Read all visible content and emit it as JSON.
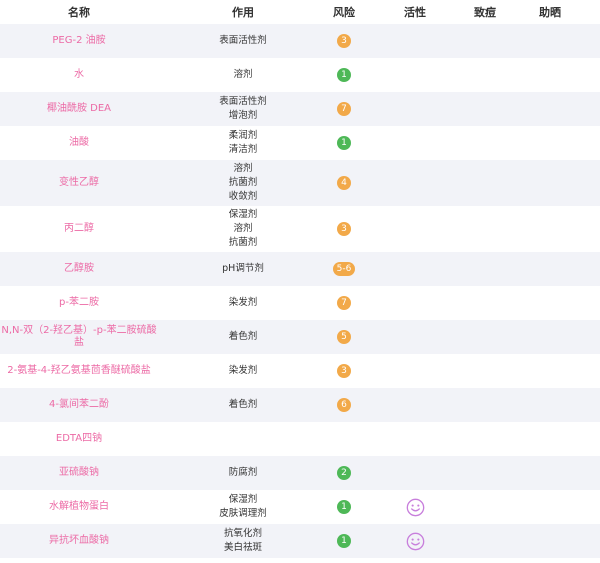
{
  "headers": {
    "name": "名称",
    "function": "作用",
    "risk": "风险",
    "active": "活性",
    "acne": "致痘",
    "acne2": "助晒"
  },
  "colors": {
    "green": "#4eb857",
    "orange": "#f2a949",
    "pink": "#ec6aa5",
    "smile": "#c87fdc"
  },
  "rows": [
    {
      "name": "PEG-2 油胺",
      "functions": [
        "表面活性剂"
      ],
      "risk": "3",
      "risk_color": "orange",
      "active": false
    },
    {
      "name": "水",
      "functions": [
        "溶剂"
      ],
      "risk": "1",
      "risk_color": "green",
      "active": false
    },
    {
      "name": "椰油酰胺 DEA",
      "functions": [
        "表面活性剂",
        "增泡剂"
      ],
      "risk": "7",
      "risk_color": "orange",
      "active": false
    },
    {
      "name": "油酸",
      "functions": [
        "柔润剂",
        "清洁剂"
      ],
      "risk": "1",
      "risk_color": "green",
      "active": false
    },
    {
      "name": "变性乙醇",
      "functions": [
        "溶剂",
        "抗菌剂",
        "收敛剂"
      ],
      "risk": "4",
      "risk_color": "orange",
      "active": false
    },
    {
      "name": "丙二醇",
      "functions": [
        "保湿剂",
        "溶剂",
        "抗菌剂"
      ],
      "risk": "3",
      "risk_color": "orange",
      "active": false
    },
    {
      "name": "乙醇胺",
      "functions": [
        "pH调节剂"
      ],
      "risk": "5-6",
      "risk_color": "orange",
      "active": false
    },
    {
      "name": "p-苯二胺",
      "functions": [
        "染发剂"
      ],
      "risk": "7",
      "risk_color": "orange",
      "active": false
    },
    {
      "name": "N,N-双（2-羟乙基）-p-苯二胺硫酸盐",
      "functions": [
        "着色剂"
      ],
      "risk": "5",
      "risk_color": "orange",
      "active": false
    },
    {
      "name": "2-氨基-4-羟乙氨基茴香醚硫酸盐",
      "functions": [
        "染发剂"
      ],
      "risk": "3",
      "risk_color": "orange",
      "active": false
    },
    {
      "name": "4-氯间苯二酚",
      "functions": [
        "着色剂"
      ],
      "risk": "6",
      "risk_color": "orange",
      "active": false
    },
    {
      "name": "EDTA四钠",
      "functions": [],
      "risk": "",
      "risk_color": "",
      "active": false
    },
    {
      "name": "亚硫酸钠",
      "functions": [
        "防腐剂"
      ],
      "risk": "2",
      "risk_color": "green",
      "active": false
    },
    {
      "name": "水解植物蛋白",
      "functions": [
        "保湿剂",
        "皮肤调理剂"
      ],
      "risk": "1",
      "risk_color": "green",
      "active": true
    },
    {
      "name": "异抗坏血酸钠",
      "functions": [
        "抗氧化剂",
        "美白祛斑"
      ],
      "risk": "1",
      "risk_color": "green",
      "active": true
    }
  ]
}
